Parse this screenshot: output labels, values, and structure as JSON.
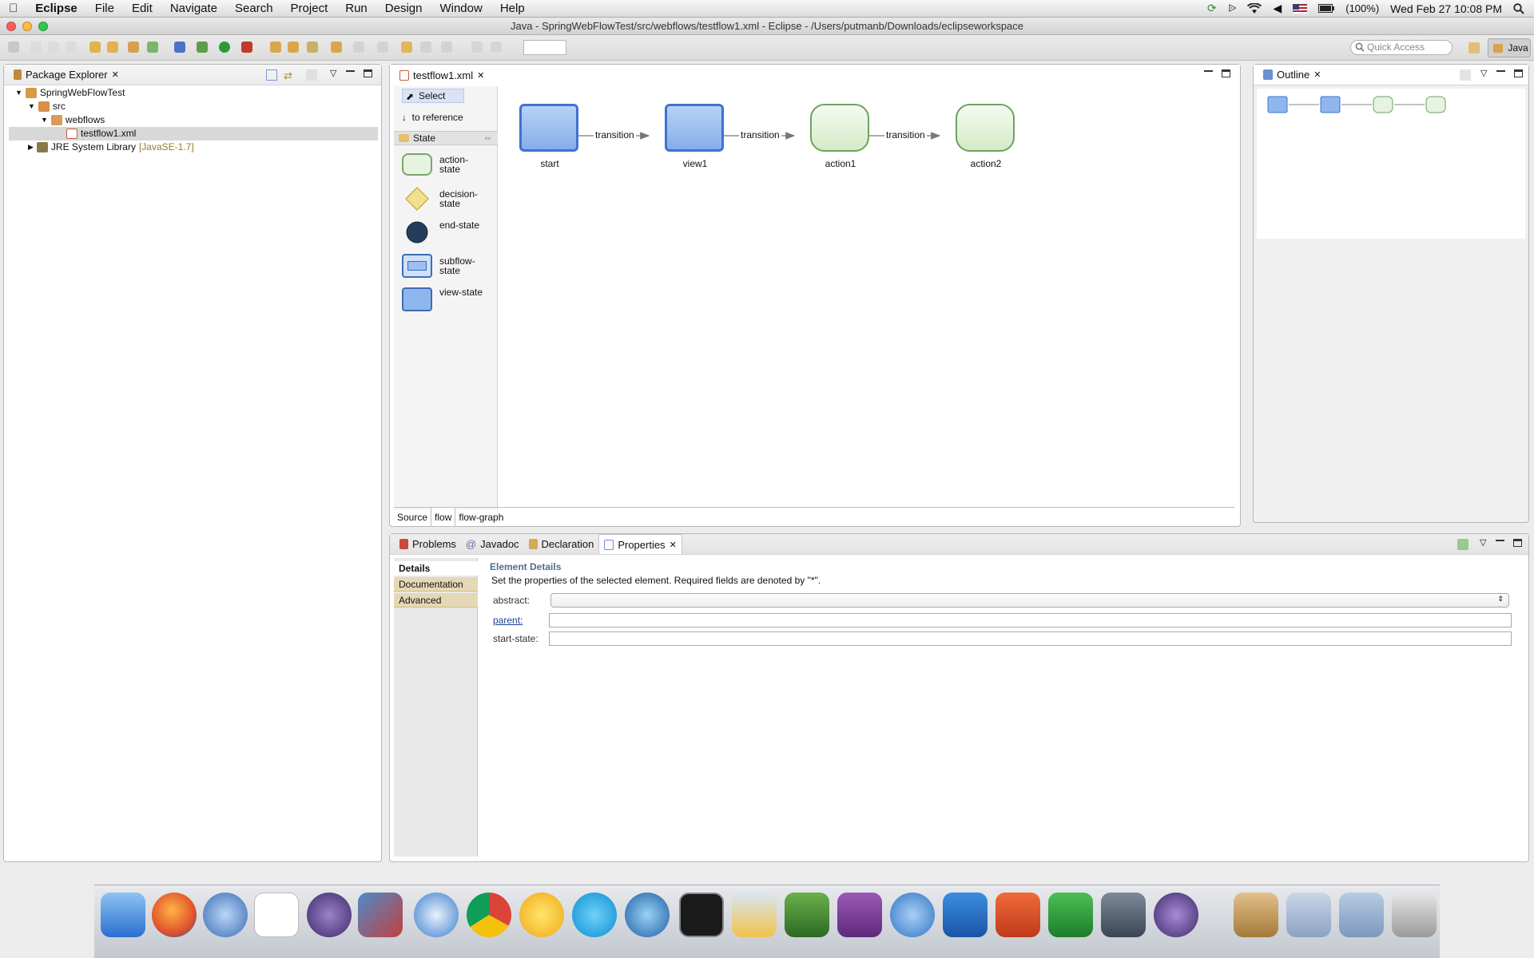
{
  "menubar": {
    "app": "Eclipse",
    "items": [
      "File",
      "Edit",
      "Navigate",
      "Search",
      "Project",
      "Run",
      "Design",
      "Window",
      "Help"
    ],
    "battery": "(100%)",
    "clock": "Wed Feb 27  10:08 PM"
  },
  "window": {
    "title": "Java - SpringWebFlowTest/src/webflows/testflow1.xml - Eclipse - /Users/putmanb/Downloads/eclipseworkspace"
  },
  "toolbar": {
    "quick_access_placeholder": "Quick Access",
    "perspective": "Java"
  },
  "package_explorer": {
    "title": "Package Explorer",
    "tree": [
      {
        "label": "SpringWebFlowTest"
      },
      {
        "label": "src"
      },
      {
        "label": "webflows"
      },
      {
        "label": "testflow1.xml"
      },
      {
        "label": "JRE System Library",
        "suffix": "[JavaSE-1.7]"
      }
    ]
  },
  "editor": {
    "tab": "testflow1.xml",
    "palette": {
      "select": "Select",
      "to_reference": "to reference",
      "group": "State",
      "items": [
        {
          "label1": "action-",
          "label2": "state"
        },
        {
          "label1": "decision-",
          "label2": "state"
        },
        {
          "label1": "end-state",
          "label2": ""
        },
        {
          "label1": "subflow-",
          "label2": "state"
        },
        {
          "label1": "view-state",
          "label2": ""
        }
      ]
    },
    "nodes": [
      {
        "label": "start"
      },
      {
        "label": "view1"
      },
      {
        "label": "action1"
      },
      {
        "label": "action2"
      }
    ],
    "transitions": [
      "transition",
      "transition",
      "transition"
    ],
    "bottom_tabs": [
      "Source",
      "flow",
      "flow-graph"
    ]
  },
  "outline": {
    "title": "Outline"
  },
  "bottom_panel": {
    "tabs": [
      "Problems",
      "Javadoc",
      "Declaration",
      "Properties"
    ],
    "sidebar_tabs": [
      "Details",
      "Documentation",
      "Advanced"
    ],
    "section_title": "Element Details",
    "description": "Set the properties of the selected element. Required fields are denoted by \"*\".",
    "fields": [
      {
        "label": "abstract:",
        "value": ""
      },
      {
        "label": "parent:",
        "value": ""
      },
      {
        "label": "start-state:",
        "value": ""
      }
    ]
  },
  "colors": {
    "view_state": "#8fb7ee",
    "action_state": "#e6f3df",
    "selection": "#d8d8d8"
  }
}
